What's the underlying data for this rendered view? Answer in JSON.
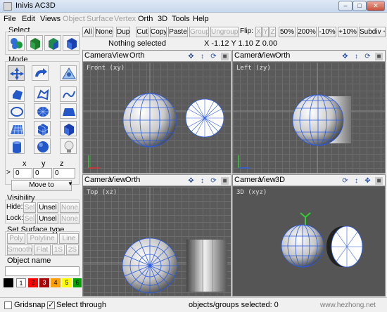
{
  "window": {
    "title": "Inivis AC3D"
  },
  "menu": [
    "File",
    "Edit",
    "Views",
    "Object",
    "Surface",
    "Vertex",
    "Orth",
    "3D",
    "Tools",
    "Help"
  ],
  "menu_disabled": [
    "Object",
    "Surface",
    "Vertex"
  ],
  "left": {
    "select_label": "Select",
    "mode_label": "Mode",
    "coords": {
      "x_label": "x",
      "y_label": "y",
      "z_label": "z",
      "arrow": ">",
      "x": "0",
      "y": "0",
      "z": "0",
      "move_to": "Move to"
    },
    "visibility_label": "Visibility",
    "hide_label": "Hide:",
    "lock_label": "Lock:",
    "sel": "Sel",
    "unsel": "Unsel",
    "none": "None",
    "surface_label": "Set Surface type",
    "surface_buttons": [
      "Poly",
      "Polyline",
      "Line",
      "Smooth",
      "Flat",
      "1S",
      "2S"
    ],
    "object_name_label": "Object name",
    "palette": [
      "",
      "1",
      "2",
      "3",
      "4",
      "5",
      "6"
    ],
    "palette_colors": [
      "#000000",
      "#ffffff",
      "#ff0000",
      "#a80000",
      "#ffa000",
      "#ffff00",
      "#00a000"
    ]
  },
  "toolbar": {
    "buttons": [
      "All",
      "None",
      "Dup",
      "Cut",
      "Copy",
      "Paste",
      "Group",
      "Ungroup"
    ],
    "flip_label": "Flip:",
    "flip_axes": [
      "X",
      "Y",
      "Z"
    ],
    "zoom_buttons": [
      "50%",
      "200%",
      "-10%",
      "+10%",
      "Subdiv +"
    ]
  },
  "status": {
    "selection": "Nothing selected",
    "coords": "X -1.12 Y 1.10 Z 0.00"
  },
  "viewports": [
    {
      "menu": [
        "Camera",
        "View",
        "Orth"
      ],
      "label": "Front (xy)"
    },
    {
      "menu": [
        "Camera",
        "View",
        "Orth"
      ],
      "label": "Left (zy)"
    },
    {
      "menu": [
        "Camera",
        "View",
        "Orth"
      ],
      "label": "Top (xz)"
    },
    {
      "menu": [
        "Camera",
        "View",
        "3D"
      ],
      "label": "3D (xyz)"
    }
  ],
  "bottom": {
    "gridsnap": "Gridsnap",
    "select_through": "Select through",
    "objects_selected": "objects/groups selected: 0"
  },
  "watermark": {
    "text": "www.hezhong.net"
  },
  "colors": {
    "accent": "#2b4f9a",
    "grid": "#5a5a5a",
    "vertex": "#1e5bd6"
  }
}
